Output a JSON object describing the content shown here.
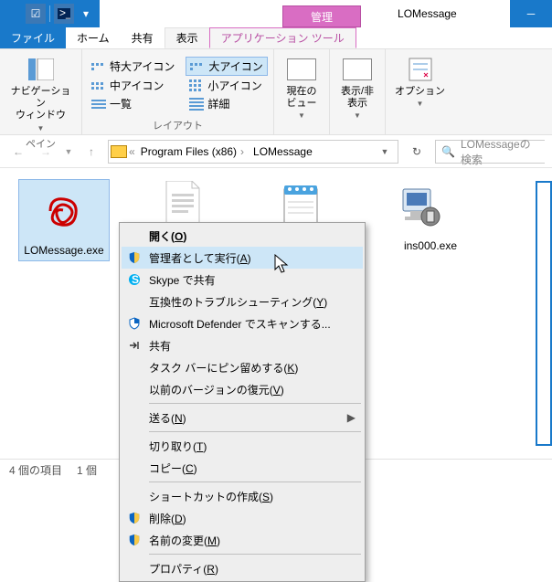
{
  "titlebar": {
    "context_tab": "管理",
    "title": "LOMessage"
  },
  "ribbon_tabs": {
    "file": "ファイル",
    "home": "ホーム",
    "share": "共有",
    "view": "表示",
    "app_tools": "アプリケーション ツール"
  },
  "ribbon": {
    "pane": {
      "nav_pane": "ナビゲーション\nウィンドウ",
      "group_label": "ペイン"
    },
    "layout": {
      "extra_large": "特大アイコン",
      "large": "大アイコン",
      "medium": "中アイコン",
      "small": "小アイコン",
      "list": "一覧",
      "details": "詳細",
      "group_label": "レイアウト"
    },
    "current_view": {
      "label": "現在の\nビュー"
    },
    "show_hide": {
      "label": "表示/非\n表示"
    },
    "options": {
      "label": "オプション"
    }
  },
  "address": {
    "crumbs": [
      "Program Files (x86)",
      "LOMessage"
    ]
  },
  "search": {
    "placeholder": "LOMessageの検索"
  },
  "files": {
    "item1": "LOMessage.exe",
    "item2_partial": "ins000.exe"
  },
  "statusbar": {
    "count": "4 個の項目",
    "selected_prefix": "1 個"
  },
  "context_menu": {
    "open": "開く(O)",
    "run_as_admin": "管理者として実行(A)",
    "skype_share": "Skype で共有",
    "compat": "互換性のトラブルシューティング(Y)",
    "defender": "Microsoft Defender でスキャンする...",
    "share": "共有",
    "pin_taskbar": "タスク バーにピン留めする(K)",
    "prev_versions": "以前のバージョンの復元(V)",
    "send_to": "送る(N)",
    "cut": "切り取り(T)",
    "copy": "コピー(C)",
    "create_shortcut": "ショートカットの作成(S)",
    "delete": "削除(D)",
    "rename": "名前の変更(M)",
    "properties": "プロパティ(R)"
  }
}
